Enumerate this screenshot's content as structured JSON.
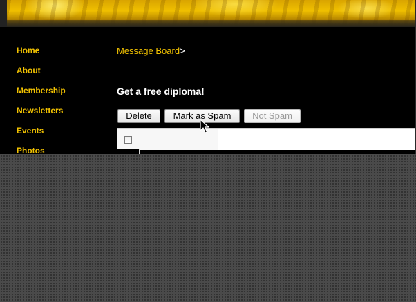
{
  "sidebar": {
    "items": [
      {
        "label": "Home"
      },
      {
        "label": "About"
      },
      {
        "label": "Membership"
      },
      {
        "label": "Newsletters"
      },
      {
        "label": "Events"
      },
      {
        "label": "Photos"
      }
    ]
  },
  "breadcrumb": {
    "link": "Message Board",
    "separator": ">"
  },
  "page": {
    "title": "Get a free diploma!"
  },
  "toolbar": {
    "delete_label": "Delete",
    "spam_label": "Mark as Spam",
    "notspam_label": "Not Spam"
  },
  "icons": {
    "cursor": "arrow-pointer-icon",
    "checkbox": "checkbox-icon"
  },
  "colors": {
    "nav_text": "#f2c200",
    "background": "#000000",
    "desktop": "#4a4a4a"
  }
}
